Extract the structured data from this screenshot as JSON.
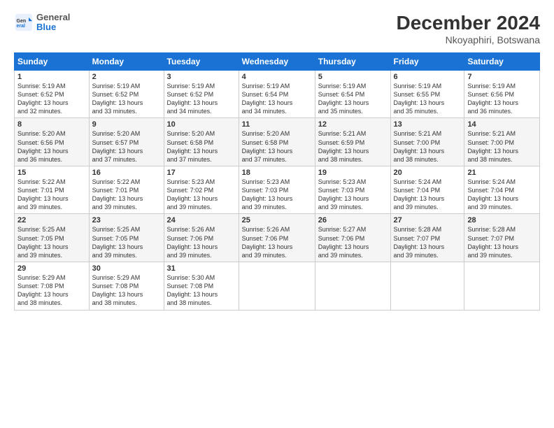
{
  "header": {
    "logo": {
      "line1": "General",
      "line2": "Blue"
    },
    "title": "December 2024",
    "subtitle": "Nkoyaphiri, Botswana"
  },
  "days_of_week": [
    "Sunday",
    "Monday",
    "Tuesday",
    "Wednesday",
    "Thursday",
    "Friday",
    "Saturday"
  ],
  "weeks": [
    [
      {
        "day": "1",
        "info": "Sunrise: 5:19 AM\nSunset: 6:52 PM\nDaylight: 13 hours\nand 32 minutes."
      },
      {
        "day": "2",
        "info": "Sunrise: 5:19 AM\nSunset: 6:52 PM\nDaylight: 13 hours\nand 33 minutes."
      },
      {
        "day": "3",
        "info": "Sunrise: 5:19 AM\nSunset: 6:52 PM\nDaylight: 13 hours\nand 34 minutes."
      },
      {
        "day": "4",
        "info": "Sunrise: 5:19 AM\nSunset: 6:54 PM\nDaylight: 13 hours\nand 34 minutes."
      },
      {
        "day": "5",
        "info": "Sunrise: 5:19 AM\nSunset: 6:54 PM\nDaylight: 13 hours\nand 35 minutes."
      },
      {
        "day": "6",
        "info": "Sunrise: 5:19 AM\nSunset: 6:55 PM\nDaylight: 13 hours\nand 35 minutes."
      },
      {
        "day": "7",
        "info": "Sunrise: 5:19 AM\nSunset: 6:56 PM\nDaylight: 13 hours\nand 36 minutes."
      }
    ],
    [
      {
        "day": "8",
        "info": "Sunrise: 5:20 AM\nSunset: 6:56 PM\nDaylight: 13 hours\nand 36 minutes."
      },
      {
        "day": "9",
        "info": "Sunrise: 5:20 AM\nSunset: 6:57 PM\nDaylight: 13 hours\nand 37 minutes."
      },
      {
        "day": "10",
        "info": "Sunrise: 5:20 AM\nSunset: 6:58 PM\nDaylight: 13 hours\nand 37 minutes."
      },
      {
        "day": "11",
        "info": "Sunrise: 5:20 AM\nSunset: 6:58 PM\nDaylight: 13 hours\nand 37 minutes."
      },
      {
        "day": "12",
        "info": "Sunrise: 5:21 AM\nSunset: 6:59 PM\nDaylight: 13 hours\nand 38 minutes."
      },
      {
        "day": "13",
        "info": "Sunrise: 5:21 AM\nSunset: 7:00 PM\nDaylight: 13 hours\nand 38 minutes."
      },
      {
        "day": "14",
        "info": "Sunrise: 5:21 AM\nSunset: 7:00 PM\nDaylight: 13 hours\nand 38 minutes."
      }
    ],
    [
      {
        "day": "15",
        "info": "Sunrise: 5:22 AM\nSunset: 7:01 PM\nDaylight: 13 hours\nand 39 minutes."
      },
      {
        "day": "16",
        "info": "Sunrise: 5:22 AM\nSunset: 7:01 PM\nDaylight: 13 hours\nand 39 minutes."
      },
      {
        "day": "17",
        "info": "Sunrise: 5:23 AM\nSunset: 7:02 PM\nDaylight: 13 hours\nand 39 minutes."
      },
      {
        "day": "18",
        "info": "Sunrise: 5:23 AM\nSunset: 7:03 PM\nDaylight: 13 hours\nand 39 minutes."
      },
      {
        "day": "19",
        "info": "Sunrise: 5:23 AM\nSunset: 7:03 PM\nDaylight: 13 hours\nand 39 minutes."
      },
      {
        "day": "20",
        "info": "Sunrise: 5:24 AM\nSunset: 7:04 PM\nDaylight: 13 hours\nand 39 minutes."
      },
      {
        "day": "21",
        "info": "Sunrise: 5:24 AM\nSunset: 7:04 PM\nDaylight: 13 hours\nand 39 minutes."
      }
    ],
    [
      {
        "day": "22",
        "info": "Sunrise: 5:25 AM\nSunset: 7:05 PM\nDaylight: 13 hours\nand 39 minutes."
      },
      {
        "day": "23",
        "info": "Sunrise: 5:25 AM\nSunset: 7:05 PM\nDaylight: 13 hours\nand 39 minutes."
      },
      {
        "day": "24",
        "info": "Sunrise: 5:26 AM\nSunset: 7:06 PM\nDaylight: 13 hours\nand 39 minutes."
      },
      {
        "day": "25",
        "info": "Sunrise: 5:26 AM\nSunset: 7:06 PM\nDaylight: 13 hours\nand 39 minutes."
      },
      {
        "day": "26",
        "info": "Sunrise: 5:27 AM\nSunset: 7:06 PM\nDaylight: 13 hours\nand 39 minutes."
      },
      {
        "day": "27",
        "info": "Sunrise: 5:28 AM\nSunset: 7:07 PM\nDaylight: 13 hours\nand 39 minutes."
      },
      {
        "day": "28",
        "info": "Sunrise: 5:28 AM\nSunset: 7:07 PM\nDaylight: 13 hours\nand 39 minutes."
      }
    ],
    [
      {
        "day": "29",
        "info": "Sunrise: 5:29 AM\nSunset: 7:08 PM\nDaylight: 13 hours\nand 38 minutes."
      },
      {
        "day": "30",
        "info": "Sunrise: 5:29 AM\nSunset: 7:08 PM\nDaylight: 13 hours\nand 38 minutes."
      },
      {
        "day": "31",
        "info": "Sunrise: 5:30 AM\nSunset: 7:08 PM\nDaylight: 13 hours\nand 38 minutes."
      },
      null,
      null,
      null,
      null
    ]
  ]
}
